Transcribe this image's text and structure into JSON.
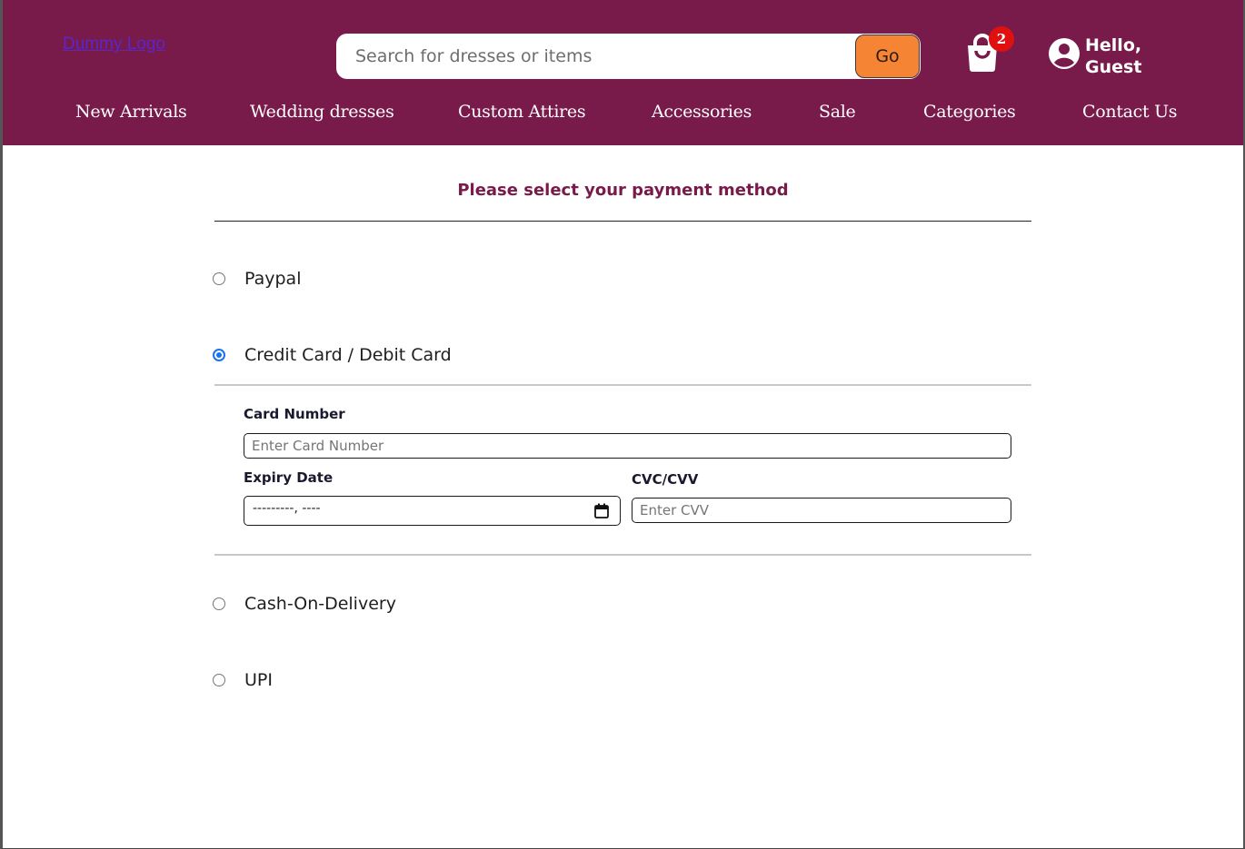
{
  "header": {
    "logo_text": "Dummy Logo",
    "search": {
      "placeholder": "Search for dresses or items",
      "button_label": "Go"
    },
    "cart": {
      "count": "2",
      "icon": "shopping-bag-icon"
    },
    "user": {
      "greeting": "Hello,\nGuest",
      "icon": "user-circle-icon"
    },
    "nav": [
      {
        "label": "New Arrivals"
      },
      {
        "label": "Wedding dresses"
      },
      {
        "label": "Custom Attires"
      },
      {
        "label": "Accessories"
      },
      {
        "label": "Sale"
      },
      {
        "label": "Categories"
      },
      {
        "label": "Contact Us"
      }
    ],
    "colors": {
      "brand": "#781b4b",
      "accent": "#f58535",
      "badge": "#e01010"
    }
  },
  "payment": {
    "title": "Please select your payment method",
    "options": [
      {
        "label": "Paypal",
        "selected": false
      },
      {
        "label": "Credit Card / Debit Card",
        "selected": true
      },
      {
        "label": "Cash-On-Delivery",
        "selected": false
      },
      {
        "label": "UPI",
        "selected": false
      }
    ],
    "card_form": {
      "card_number_label": "Card Number",
      "card_number_placeholder": "Enter Card Number",
      "expiry_label": "Expiry Date",
      "expiry_value": "---------, ----",
      "cvv_label": "CVC/CVV",
      "cvv_placeholder": "Enter CVV"
    }
  }
}
